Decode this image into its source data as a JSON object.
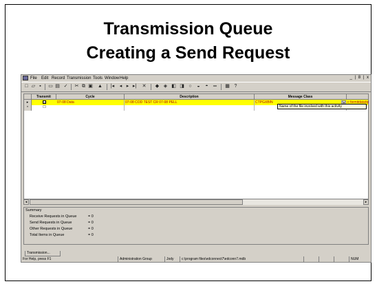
{
  "slide": {
    "title_line1": "Transmission Queue",
    "title_line2": "Creating a Send Request"
  },
  "app": {
    "menu": [
      "File",
      "Edit",
      "Record",
      "Transmission",
      "Tools",
      "Window",
      "Help"
    ],
    "window_controls": "_ | 8 | x",
    "toolbar_icons": [
      "new-icon",
      "open-icon",
      "save-icon",
      "print-preview-icon",
      "print-icon",
      "spell-icon",
      "cut-icon",
      "copy-icon",
      "paste-icon",
      "find-icon",
      "first-record-icon",
      "prev-record-icon",
      "next-record-icon",
      "last-record-icon",
      "delete-icon",
      "transmission-icons",
      "help-icon"
    ],
    "grid": {
      "columns": [
        "",
        "Transmit",
        "Cycle",
        "Description",
        "Message Class",
        ""
      ],
      "rows": [
        {
          "selector": "▸",
          "transmit": "☑",
          "cycle": "07-08 Data",
          "description": "07-08 COD TEST CR 07-08 PELL",
          "message_class": "CTPGXBIN",
          "file": "c:\\temitdata\\tpgx08in"
        },
        {
          "selector": "*",
          "transmit": "☐",
          "cycle": "",
          "description": "",
          "message_class": "",
          "file": ""
        }
      ],
      "tooltip": "Name of the file involved with this activity"
    },
    "summary": {
      "title": "Summary",
      "lines": [
        {
          "label": "Receive Requests in Queue",
          "value": "= 0"
        },
        {
          "label": "Send Requests in Queue",
          "value": "= 0"
        },
        {
          "label": "Other Requests in Queue",
          "value": "= 0"
        },
        {
          "label": "Total Items in Queue",
          "value": "= 0"
        }
      ]
    },
    "tab": "Transmission...",
    "status": {
      "help": "For Help, press F1",
      "group": "Administration Group",
      "user": "Jody",
      "path": "c:\\program files\\edconnect7\\edconn7.mdb",
      "num": "NUM"
    }
  }
}
